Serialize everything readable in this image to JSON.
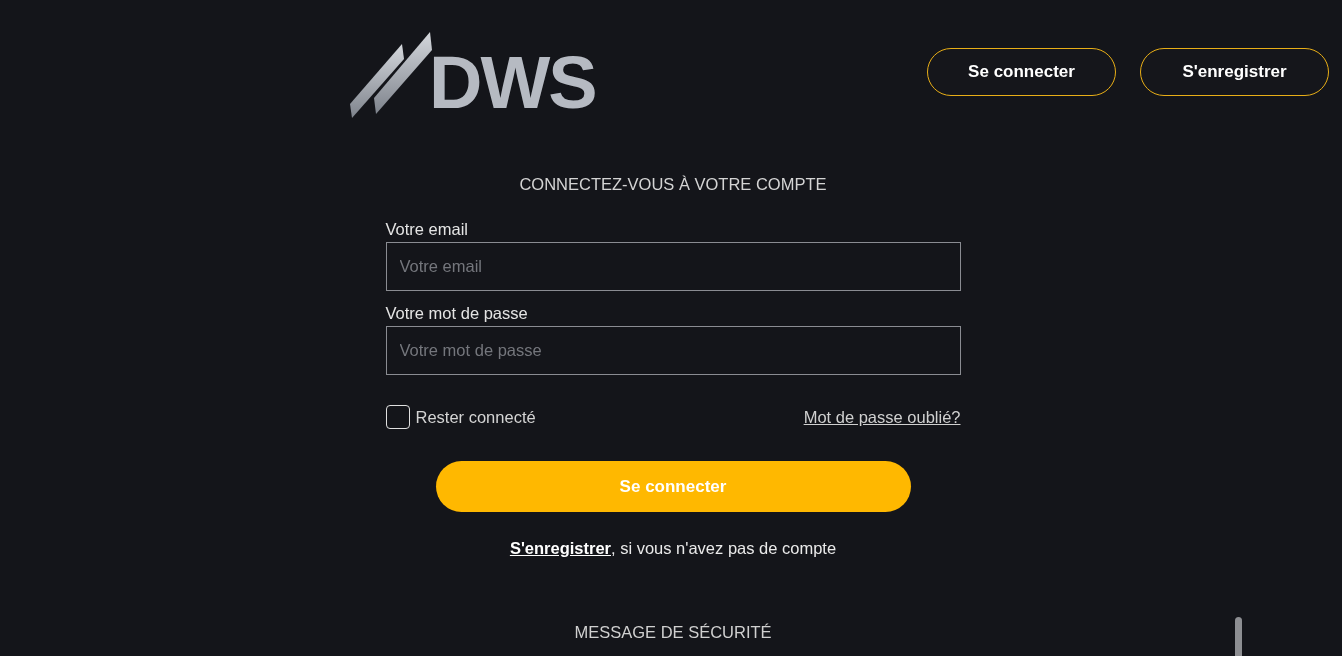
{
  "logo": {
    "text": "DWS"
  },
  "header_buttons": [
    {
      "label": "Se connecter"
    },
    {
      "label": "S'enregistrer"
    }
  ],
  "login_form": {
    "title": "CONNECTEZ-VOUS À VOTRE COMPTE",
    "fields": [
      {
        "label": "Votre email",
        "placeholder": "Votre email"
      },
      {
        "label": "Votre mot de passe",
        "placeholder": "Votre mot de passe"
      }
    ],
    "remember_me": {
      "label": "Rester connecté",
      "checked": false
    },
    "forgot_password_link": "Mot de passe oublié?",
    "submit_button": "Se connecter",
    "register_prompt": {
      "link": "S'enregistrer",
      "text": ", si vous n'avez pas de compte"
    }
  },
  "security_message": {
    "title": "MESSAGE DE SÉCURITÉ"
  }
}
